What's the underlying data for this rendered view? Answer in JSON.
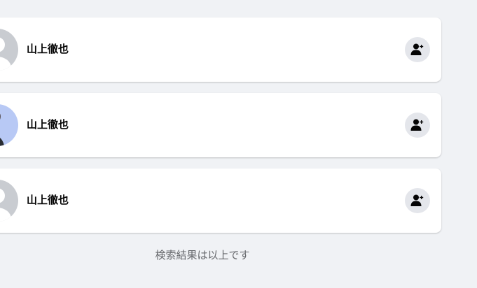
{
  "results": [
    {
      "name": "山上徹也",
      "avatar": "default-avatar-icon"
    },
    {
      "name": "山上徹也",
      "avatar": "cartoon-photo"
    },
    {
      "name": "山上徹也",
      "avatar": "default-avatar-icon"
    }
  ],
  "add_friend_icon": "person-add-icon",
  "end_of_results": "検索結果は以上です",
  "colors": {
    "background": "#f0f2f5",
    "card": "#ffffff",
    "button_bg": "#e4e6eb",
    "icon": "#050505",
    "secondary_text": "#65676b"
  }
}
